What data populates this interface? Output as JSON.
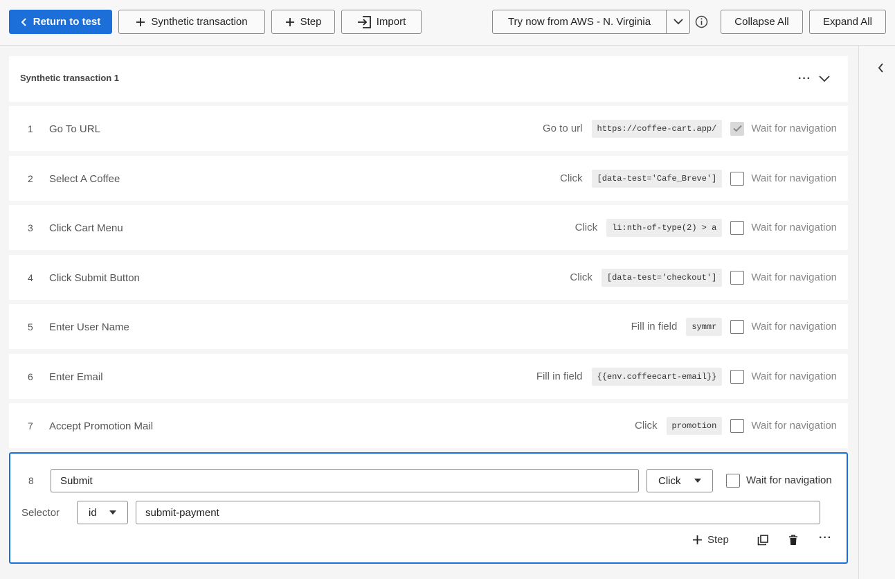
{
  "toolbar": {
    "return_label": "Return to test",
    "synthetic_label": "Synthetic transaction",
    "step_label": "Step",
    "import_label": "Import",
    "try_label": "Try now from AWS - N. Virginia",
    "collapse_label": "Collapse All",
    "expand_label": "Expand All"
  },
  "transaction": {
    "title": "Synthetic transaction 1",
    "more": "···"
  },
  "wait_label": "Wait for navigation",
  "steps": [
    {
      "num": "1",
      "name": "Go To URL",
      "action": "Go to url",
      "selector": "https://coffee-cart.app/",
      "wait_checked": true
    },
    {
      "num": "2",
      "name": "Select A Coffee",
      "action": "Click",
      "selector": "[data-test='Cafe_Breve']",
      "wait_checked": false
    },
    {
      "num": "3",
      "name": "Click Cart Menu",
      "action": "Click",
      "selector": "li:nth-of-type(2) > a",
      "wait_checked": false
    },
    {
      "num": "4",
      "name": "Click Submit Button",
      "action": "Click",
      "selector": "[data-test='checkout']",
      "wait_checked": false
    },
    {
      "num": "5",
      "name": "Enter User Name",
      "action": "Fill in field",
      "selector": "symmr",
      "wait_checked": false
    },
    {
      "num": "6",
      "name": "Enter Email",
      "action": "Fill in field",
      "selector": "{{env.coffeecart-email}}",
      "wait_checked": false
    },
    {
      "num": "7",
      "name": "Accept Promotion Mail",
      "action": "Click",
      "selector": "promotion",
      "wait_checked": false
    }
  ],
  "active_step": {
    "num": "8",
    "name_value": "Submit",
    "action_value": "Click",
    "wait_label": "Wait for navigation",
    "wait_checked": false,
    "selector_label": "Selector",
    "selector_type": "id",
    "selector_value": "submit-payment",
    "add_step_label": "Step",
    "more": "···"
  },
  "colors": {
    "primary": "#1c6fd8",
    "step_bg": "#ffffff",
    "page_bg": "#f5f5f5"
  }
}
